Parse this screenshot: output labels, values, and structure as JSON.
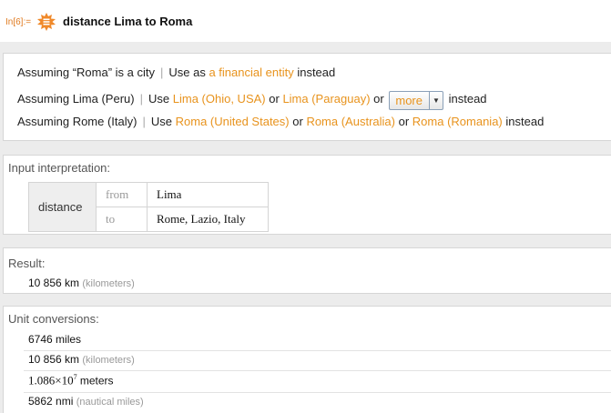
{
  "input": {
    "label": "In[6]:=",
    "query": "distance Lima to Roma"
  },
  "assumptions": {
    "line1": {
      "prefix": "Assuming “Roma” is a city",
      "use_as": "Use as",
      "link": "a financial entity",
      "suffix": "instead"
    },
    "line2": {
      "prefix": "Assuming Lima (Peru)",
      "use": "Use",
      "link1": "Lima (Ohio, USA)",
      "or1": "or",
      "link2": "Lima (Paraguay)",
      "or2": "or",
      "more": "more",
      "suffix": "instead"
    },
    "line3": {
      "prefix": "Assuming Rome (Italy)",
      "use": "Use",
      "link1": "Roma (United States)",
      "or1": "or",
      "link2": "Roma (Australia)",
      "or2": "or",
      "link3": "Roma (Romania)",
      "suffix": "instead"
    }
  },
  "interpretation": {
    "title": "Input interpretation:",
    "key": "distance",
    "rows": [
      {
        "label": "from",
        "value": "Lima"
      },
      {
        "label": "to",
        "value": "Rome, Lazio, Italy"
      }
    ]
  },
  "result": {
    "title": "Result:",
    "value": "10 856 km",
    "unit": "(kilometers)"
  },
  "conversions": {
    "title": "Unit conversions:",
    "rows": [
      {
        "value": "6746 miles",
        "unit": ""
      },
      {
        "value": "10 856 km",
        "unit": "(kilometers)"
      },
      {
        "mantissa": "1.086",
        "times": "×",
        "base": "10",
        "exp": "7",
        "unit": "meters"
      },
      {
        "value": "5862 nmi",
        "unit": "(nautical miles)"
      }
    ]
  },
  "colors": {
    "link": "#e8931d",
    "in_label": "#e07a1f",
    "icon": "#f0892a"
  }
}
